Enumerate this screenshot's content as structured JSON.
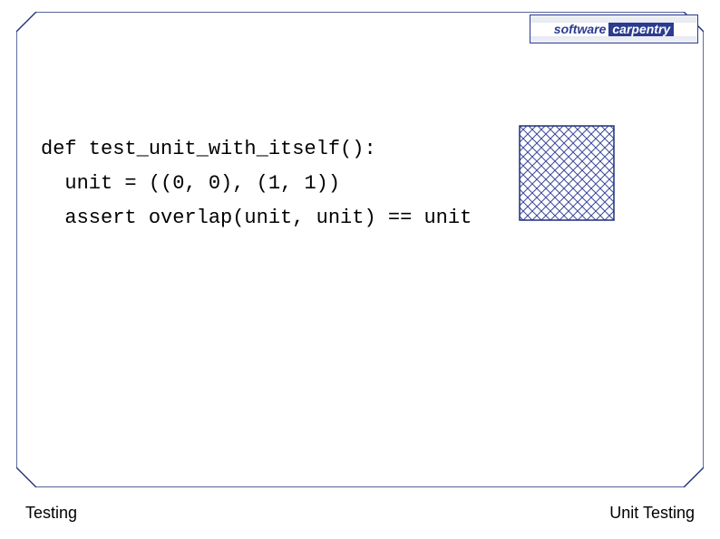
{
  "logo": {
    "word1": "software",
    "word2": "carpentry"
  },
  "code": {
    "line1": "def test_unit_with_itself():",
    "line2": "  unit = ((0, 0), (1, 1))",
    "line3": "  assert overlap(unit, unit) == unit"
  },
  "footer": {
    "left": "Testing",
    "right": "Unit Testing"
  },
  "colors": {
    "border": "#1f2f7a",
    "hatch": "#3a4a9c"
  }
}
